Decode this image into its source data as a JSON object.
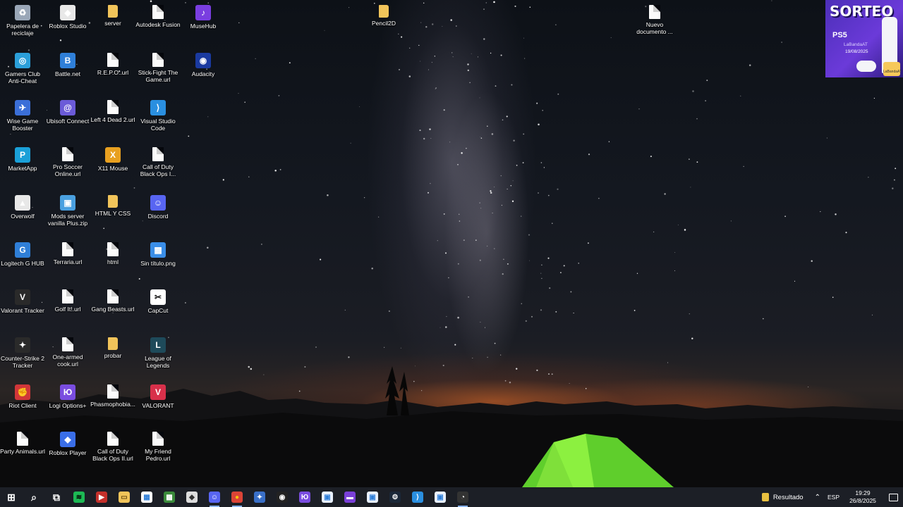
{
  "desktop": {
    "icons": [
      {
        "label": "Papelera de reciclaje",
        "icon": "recycle-bin-icon",
        "color": "#9aa7b8",
        "glyph": "♻",
        "kind": "app"
      },
      {
        "label": "Gamers Club Anti-Cheat",
        "icon": "gamers-club-icon",
        "color": "#2b9fd9",
        "glyph": "◎",
        "kind": "app"
      },
      {
        "label": "Wise Game Booster",
        "icon": "wise-game-booster-icon",
        "color": "#3b6fd8",
        "glyph": "✈",
        "kind": "app"
      },
      {
        "label": "MarketApp",
        "icon": "marketapp-icon",
        "color": "#1aa0d8",
        "glyph": "P",
        "kind": "app"
      },
      {
        "label": "Overwolf",
        "icon": "overwolf-icon",
        "color": "#e8e8e8",
        "glyph": "▲",
        "kind": "app"
      },
      {
        "label": "Logitech G HUB",
        "icon": "logitech-ghub-icon",
        "color": "#2f7fd8",
        "glyph": "G",
        "kind": "app"
      },
      {
        "label": "Valorant Tracker",
        "icon": "valorant-tracker-icon",
        "color": "#2a2a2a",
        "glyph": "V",
        "kind": "app"
      },
      {
        "label": "Counter-Strike 2 Tracker",
        "icon": "cs2-tracker-icon",
        "color": "#2a2a2a",
        "glyph": "✦",
        "kind": "app"
      },
      {
        "label": "Riot Client",
        "icon": "riot-client-icon",
        "color": "#d13639",
        "glyph": "✊",
        "kind": "app"
      },
      {
        "label": "Party Animals.url",
        "icon": "url-file-icon",
        "color": "#ffffff",
        "glyph": "",
        "kind": "file"
      },
      {
        "label": "Roblox Studio",
        "icon": "roblox-studio-icon",
        "color": "#e8e8e8",
        "glyph": "◆",
        "kind": "app"
      },
      {
        "label": "Battle.net",
        "icon": "battlenet-icon",
        "color": "#2f7fd8",
        "glyph": "B",
        "kind": "app"
      },
      {
        "label": "Ubisoft Connect",
        "icon": "ubisoft-connect-icon",
        "color": "#6b5bd8",
        "glyph": "@",
        "kind": "app"
      },
      {
        "label": "Pro Soccer Online.url",
        "icon": "url-file-icon",
        "color": "#ffffff",
        "glyph": "",
        "kind": "file"
      },
      {
        "label": "Mods server vanilla Plus.zip",
        "icon": "zip-file-icon",
        "color": "#4aa0e0",
        "glyph": "▣",
        "kind": "app"
      },
      {
        "label": "Terraria.url",
        "icon": "url-file-icon",
        "color": "#ffffff",
        "glyph": "",
        "kind": "file"
      },
      {
        "label": "Golf It!.url",
        "icon": "url-file-icon",
        "color": "#ffffff",
        "glyph": "",
        "kind": "file"
      },
      {
        "label": "One-armed cook.url",
        "icon": "url-file-icon",
        "color": "#ffffff",
        "glyph": "",
        "kind": "file"
      },
      {
        "label": "Logi Options+",
        "icon": "logi-options-icon",
        "color": "#7a4de0",
        "glyph": "Ю",
        "kind": "app"
      },
      {
        "label": "Roblox Player",
        "icon": "roblox-player-icon",
        "color": "#3a6ee8",
        "glyph": "◆",
        "kind": "app"
      },
      {
        "label": "server",
        "icon": "folder-icon",
        "color": "#f1c45a",
        "glyph": "",
        "kind": "folder"
      },
      {
        "label": "R.E.P.O..url",
        "icon": "url-file-icon",
        "color": "#ffffff",
        "glyph": "",
        "kind": "file"
      },
      {
        "label": "Left 4 Dead 2.url",
        "icon": "url-file-icon",
        "color": "#ffffff",
        "glyph": "",
        "kind": "file"
      },
      {
        "label": "X11 Mouse",
        "icon": "x11-mouse-icon",
        "color": "#e8a020",
        "glyph": "X",
        "kind": "app"
      },
      {
        "label": "HTML Y CSS",
        "icon": "folder-icon",
        "color": "#f1c45a",
        "glyph": "",
        "kind": "folder"
      },
      {
        "label": "html",
        "icon": "url-file-icon",
        "color": "#ffffff",
        "glyph": "",
        "kind": "file"
      },
      {
        "label": "Gang Beasts.url",
        "icon": "url-file-icon",
        "color": "#ffffff",
        "glyph": "",
        "kind": "file"
      },
      {
        "label": "probar",
        "icon": "folder-icon",
        "color": "#f1c45a",
        "glyph": "",
        "kind": "folder"
      },
      {
        "label": "Phasmophobia...",
        "icon": "url-file-icon",
        "color": "#ffffff",
        "glyph": "",
        "kind": "file"
      },
      {
        "label": "Call of Duty Black Ops II.url",
        "icon": "url-file-icon",
        "color": "#ffffff",
        "glyph": "",
        "kind": "file"
      },
      {
        "label": "Autodesk Fusion",
        "icon": "url-file-icon",
        "color": "#ffffff",
        "glyph": "",
        "kind": "file"
      },
      {
        "label": "Stick Fight The Game.url",
        "icon": "url-file-icon",
        "color": "#ffffff",
        "glyph": "",
        "kind": "file"
      },
      {
        "label": "Visual Studio Code",
        "icon": "vscode-icon",
        "color": "#2a8fe0",
        "glyph": "⟩",
        "kind": "app"
      },
      {
        "label": "Call of Duty Black Ops I...",
        "icon": "url-file-icon",
        "color": "#ffffff",
        "glyph": "",
        "kind": "file"
      },
      {
        "label": "Discord",
        "icon": "discord-icon",
        "color": "#5865f2",
        "glyph": "☺",
        "kind": "app"
      },
      {
        "label": "Sin título.png",
        "icon": "png-file-icon",
        "color": "#3a8ee8",
        "glyph": "▦",
        "kind": "app"
      },
      {
        "label": "CapCut",
        "icon": "capcut-icon",
        "color": "#ffffff",
        "glyph": "✂",
        "kind": "app",
        "dark": true
      },
      {
        "label": "League of Legends",
        "icon": "league-of-legends-icon",
        "color": "#1e4a5a",
        "glyph": "L",
        "kind": "app"
      },
      {
        "label": "VALORANT",
        "icon": "valorant-icon",
        "color": "#d8304a",
        "glyph": "V",
        "kind": "app"
      },
      {
        "label": "My Friend Pedro.url",
        "icon": "url-file-icon",
        "color": "#ffffff",
        "glyph": "",
        "kind": "file"
      },
      {
        "label": "MuseHub",
        "icon": "musehub-icon",
        "color": "#7a3ee0",
        "glyph": "♪",
        "kind": "app"
      },
      {
        "label": "Audacity",
        "icon": "audacity-icon",
        "color": "#1a3aa0",
        "glyph": "◉",
        "kind": "app"
      },
      {
        "label": "Pencil2D",
        "icon": "folder-icon",
        "color": "#f1c45a",
        "glyph": "",
        "kind": "folder"
      },
      {
        "label": "Nuevo documento ...",
        "icon": "text-document-icon",
        "color": "#ffffff",
        "glyph": "",
        "kind": "file"
      }
    ]
  },
  "promo": {
    "title": "SORTEO",
    "product": "PS5",
    "brand": "LaBandaAT",
    "date": "19/08/2025",
    "logo": "LaBandaAT"
  },
  "taskbar": {
    "apps": [
      {
        "icon": "start-icon",
        "glyph": "⊞",
        "color": "#ffffff",
        "bg": "transparent"
      },
      {
        "icon": "search-icon",
        "glyph": "⌕",
        "color": "#ffffff",
        "bg": "transparent"
      },
      {
        "icon": "task-view-icon",
        "glyph": "⧉",
        "color": "#ffffff",
        "bg": "transparent"
      },
      {
        "icon": "spotify-icon",
        "glyph": "≋",
        "color": "#000000",
        "bg": "#1db954",
        "running": false
      },
      {
        "icon": "youtube-music-icon",
        "glyph": "▶",
        "color": "#ffffff",
        "bg": "#c4302b",
        "running": false
      },
      {
        "icon": "file-explorer-icon",
        "glyph": "▭",
        "color": "#6b4d10",
        "bg": "#f1c45a",
        "running": false
      },
      {
        "icon": "microsoft-store-icon",
        "glyph": "▦",
        "color": "#2f7fd8",
        "bg": "#ffffff",
        "running": false
      },
      {
        "icon": "minecraft-icon",
        "glyph": "▩",
        "color": "#ffffff",
        "bg": "#3a8a3a",
        "running": false
      },
      {
        "icon": "shield-app-icon",
        "glyph": "◆",
        "color": "#333333",
        "bg": "#dddddd",
        "running": false
      },
      {
        "icon": "discord-taskbar-icon",
        "glyph": "☺",
        "color": "#ffffff",
        "bg": "#5865f2",
        "running": true
      },
      {
        "icon": "chrome-icon",
        "glyph": "●",
        "color": "#f4c20d",
        "bg": "#db4437",
        "running": true
      },
      {
        "icon": "cs-tool-icon",
        "glyph": "✦",
        "color": "#ffffff",
        "bg": "#3a70c8",
        "running": false
      },
      {
        "icon": "obs-icon",
        "glyph": "◉",
        "color": "#ffffff",
        "bg": "#222222",
        "running": false
      },
      {
        "icon": "logi-options-taskbar-icon",
        "glyph": "Ю",
        "color": "#ffffff",
        "bg": "#7a4de0",
        "running": false
      },
      {
        "icon": "window-app-icon",
        "glyph": "▣",
        "color": "#2f7fd8",
        "bg": "#e8f0ff",
        "running": false
      },
      {
        "icon": "video-app-icon",
        "glyph": "▬",
        "color": "#ffffff",
        "bg": "#7a40d8",
        "running": false
      },
      {
        "icon": "window-app-2-icon",
        "glyph": "▣",
        "color": "#2f7fd8",
        "bg": "#e8f0ff",
        "running": false
      },
      {
        "icon": "steam-icon",
        "glyph": "⚙",
        "color": "#ffffff",
        "bg": "#1b2838",
        "running": false
      },
      {
        "icon": "vscode-taskbar-icon",
        "glyph": "⟩",
        "color": "#ffffff",
        "bg": "#2a8fe0",
        "running": false
      },
      {
        "icon": "window-app-3-icon",
        "glyph": "▣",
        "color": "#2f7fd8",
        "bg": "#e8f0ff",
        "running": false
      },
      {
        "icon": "recording-app-icon",
        "glyph": "◔",
        "color": "#ffffff",
        "bg": "#333333",
        "running": true
      }
    ],
    "tray": {
      "weather_label": "Resultado",
      "language": "ESP",
      "time": "19:29",
      "date": "26/8/2025"
    }
  }
}
